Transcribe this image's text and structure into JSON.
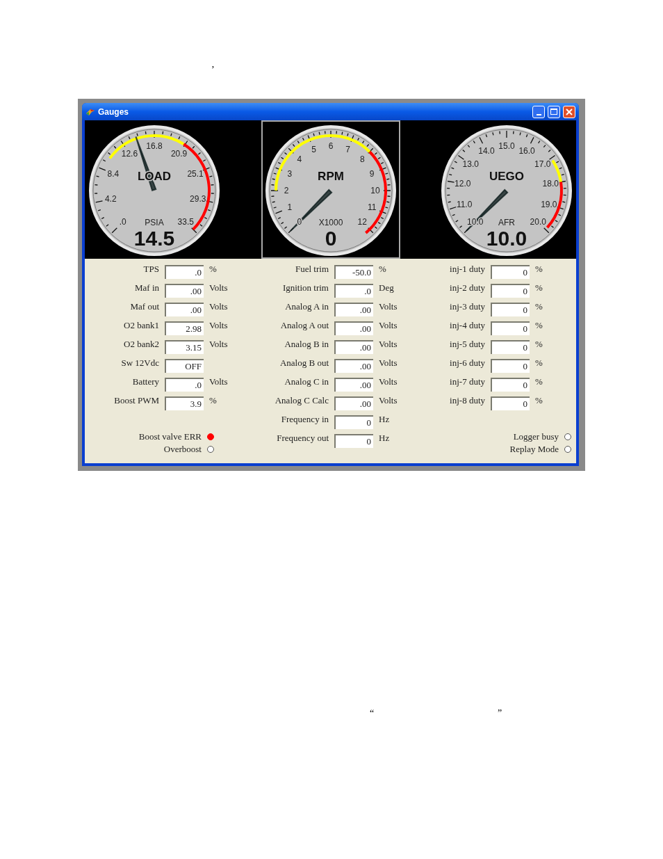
{
  "marks": [
    "’",
    "“",
    "”"
  ],
  "window": {
    "title": "Gauges"
  },
  "gauges": [
    {
      "title": "LOAD",
      "unit": "PSIA",
      "reading": "14.5",
      "selected": false,
      "scale_labels": [
        ".0",
        "4.2",
        "8.4",
        "12.6",
        "16.8",
        "20.9",
        "25.1",
        "29.3",
        "33.5"
      ]
    },
    {
      "title": "RPM",
      "unit": "X1000",
      "reading": "0",
      "selected": true,
      "scale_labels": [
        "0",
        "1",
        "2",
        "3",
        "4",
        "5",
        "6",
        "7",
        "8",
        "9",
        "10",
        "11",
        "12"
      ]
    },
    {
      "title": "UEGO",
      "unit": "AFR",
      "reading": "10.0",
      "selected": false,
      "scale_labels": [
        "10.0",
        "11.0",
        "12.0",
        "13.0",
        "14.0",
        "15.0",
        "16.0",
        "17.0",
        "18.0",
        "19.0",
        "20.0"
      ]
    }
  ],
  "columns": [
    {
      "rows": [
        {
          "label": "TPS",
          "value": ".0",
          "unit": "%"
        },
        {
          "label": "Maf in",
          "value": ".00",
          "unit": "Volts"
        },
        {
          "label": "Maf out",
          "value": ".00",
          "unit": "Volts"
        },
        {
          "label": "O2 bank1",
          "value": "2.98",
          "unit": "Volts"
        },
        {
          "label": "O2 bank2",
          "value": "3.15",
          "unit": "Volts"
        },
        {
          "label": "Sw 12Vdc",
          "value": "OFF"
        },
        {
          "label": "Battery",
          "value": ".0",
          "unit": "Volts"
        },
        {
          "label": "Boost PWM",
          "value": "3.9",
          "unit": "%"
        }
      ],
      "indicators": [
        {
          "label": "Boost valve ERR",
          "on": true
        },
        {
          "label": "Overboost",
          "on": false
        }
      ]
    },
    {
      "rows": [
        {
          "label": "Fuel trim",
          "value": "-50.0",
          "unit": "%"
        },
        {
          "label": "Ignition trim",
          "value": ".0",
          "unit": "Deg"
        },
        {
          "label": "Analog A in",
          "value": ".00",
          "unit": "Volts"
        },
        {
          "label": "Analog A out",
          "value": ".00",
          "unit": "Volts"
        },
        {
          "label": "Analog B in",
          "value": ".00",
          "unit": "Volts"
        },
        {
          "label": "Analog B out",
          "value": ".00",
          "unit": "Volts"
        },
        {
          "label": "Analog C in",
          "value": ".00",
          "unit": "Volts"
        },
        {
          "label": "Analog C Calc",
          "value": ".00",
          "unit": "Volts"
        },
        {
          "label": "Frequency in",
          "value": "0",
          "unit": "Hz"
        },
        {
          "label": "Frequency out",
          "value": "0",
          "unit": "Hz"
        }
      ]
    },
    {
      "rows": [
        {
          "label": "inj-1 duty",
          "value": "0",
          "unit": "%"
        },
        {
          "label": "inj-2 duty",
          "value": "0",
          "unit": "%"
        },
        {
          "label": "inj-3 duty",
          "value": "0",
          "unit": "%"
        },
        {
          "label": "inj-4 duty",
          "value": "0",
          "unit": "%"
        },
        {
          "label": "inj-5 duty",
          "value": "0",
          "unit": "%"
        },
        {
          "label": "inj-6 duty",
          "value": "0",
          "unit": "%"
        },
        {
          "label": "inj-7 duty",
          "value": "0",
          "unit": "%"
        },
        {
          "label": "inj-8 duty",
          "value": "0",
          "unit": "%"
        }
      ],
      "indicators": [
        {
          "label": "Logger busy",
          "on": false
        },
        {
          "label": "Replay Mode",
          "on": false
        }
      ]
    }
  ]
}
